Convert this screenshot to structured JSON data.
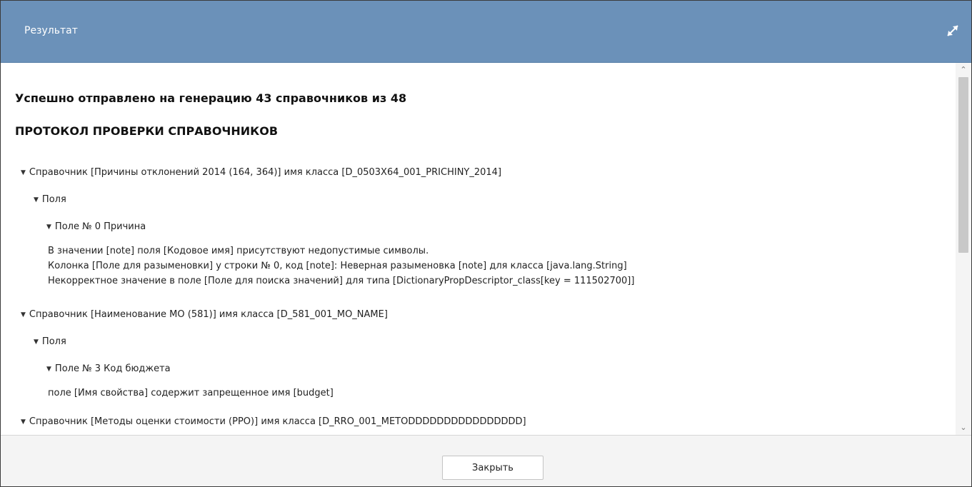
{
  "window": {
    "title": "Результат",
    "expand_icon": "expand-arrows-icon"
  },
  "summary": {
    "success_text": "Успешно отправлено на генерацию 43 справочников из 48",
    "protocol_title": "ПРОТОКОЛ ПРОВЕРКИ СПРАВОЧНИКОВ"
  },
  "tree": {
    "dict1": {
      "label": "Справочник [Причины отклонений 2014 (164, 364)] имя класса [D_0503X64_001_PRICHINY_2014]",
      "fields_label": "Поля",
      "field_label": "Поле № 0 Причина",
      "messages": [
        "В значении [note] поля [Кодовое имя] присутствуют недопустимые символы.",
        "Колонка [Поле для разыменовки] у строки № 0, код [note]: Неверная разыменовка [note] для класса [java.lang.String]",
        "Некорректное значение в поле [Поле для поиска значений] для типа [DictionaryPropDescriptor_class[key = 111502700]]"
      ]
    },
    "dict2": {
      "label": "Справочник [Наименование МО (581)] имя класса [D_581_001_MO_NAME]",
      "fields_label": "Поля",
      "field_label": "Поле № 3 Код бюджета",
      "messages": [
        "поле [Имя свойства] содержит запрещенное имя [budget]"
      ]
    },
    "dict3": {
      "label": "Справочник [Методы оценки стоимости (РРО)] имя класса [D_RRO_001_METODDDDDDDDDDDDDDDD]"
    }
  },
  "footer": {
    "close_label": "Закрыть"
  },
  "colors": {
    "titlebar": "#6b91b9",
    "footer": "#f4f4f4"
  }
}
